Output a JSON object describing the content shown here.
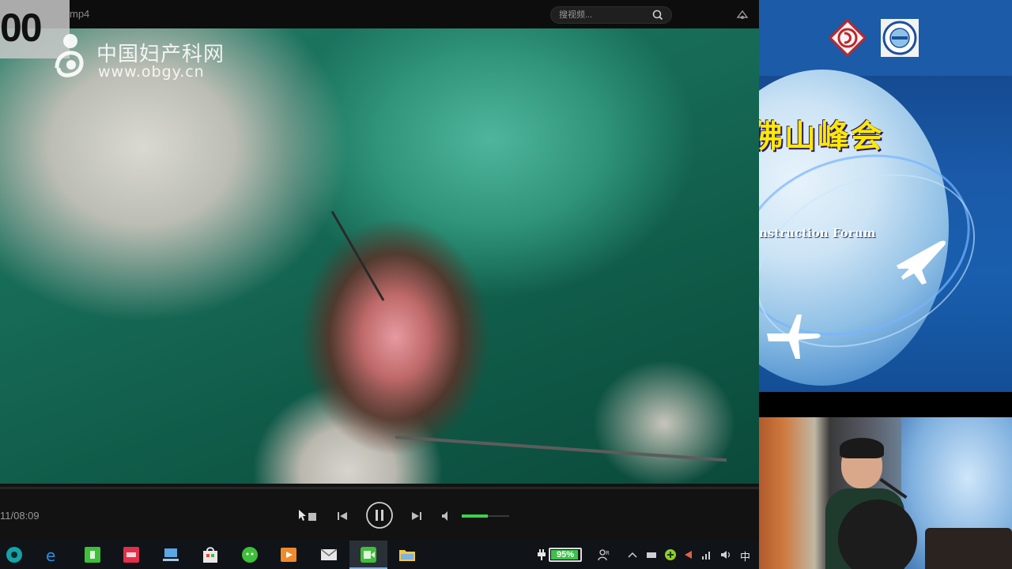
{
  "player": {
    "file_title": "mp4",
    "search_placeholder": "搜视频...",
    "timecode_overlay": "00",
    "time_readout": "11/08:09",
    "volume_level": 0.55
  },
  "watermark": {
    "site_name": "中国妇产科网",
    "site_url": "www.obgy.cn"
  },
  "taskbar": {
    "battery_percent": "95%",
    "battery_level": 0.95,
    "ime_label": "中",
    "icons": [
      "start-icon",
      "edge-icon",
      "green-app-icon",
      "red-app-icon",
      "computer-icon",
      "store-icon",
      "chat-icon",
      "media-icon",
      "mail-icon",
      "video-app-icon",
      "folder-icon"
    ]
  },
  "slide": {
    "title": "佛山峰会",
    "subtitle": "nstruction Forum"
  },
  "colors": {
    "slide_title": "#ffe800",
    "accent_green": "#3ad34a",
    "slide_blue": "#1a5aa8"
  }
}
